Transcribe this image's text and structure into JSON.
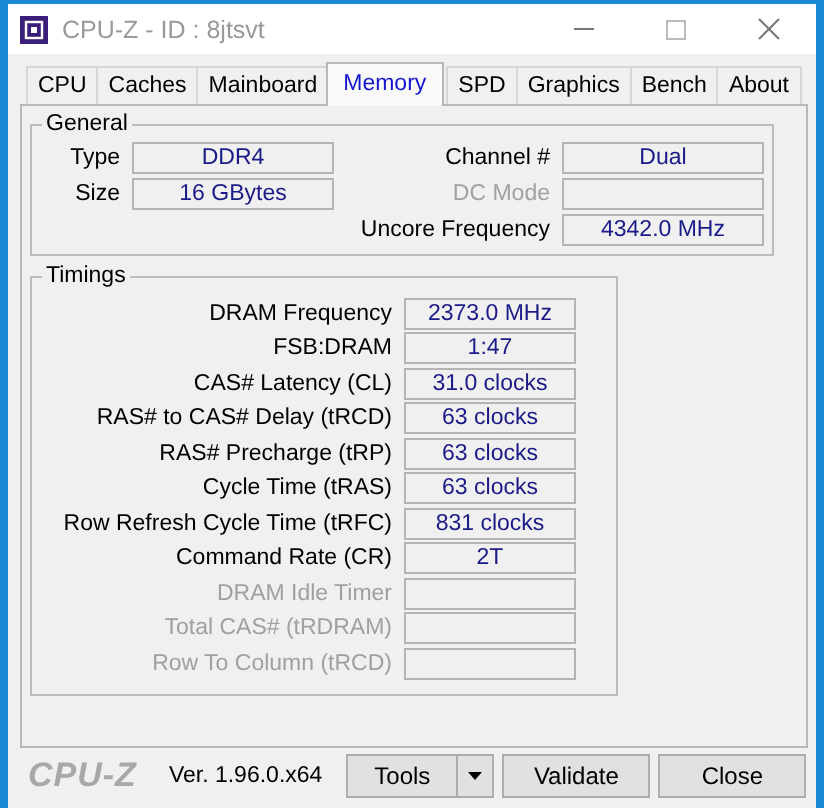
{
  "window": {
    "title": "CPU-Z - ID : 8jtsvt"
  },
  "tabs": [
    {
      "label": "CPU",
      "selected": false
    },
    {
      "label": "Caches",
      "selected": false
    },
    {
      "label": "Mainboard",
      "selected": false
    },
    {
      "label": "Memory",
      "selected": true
    },
    {
      "label": "SPD",
      "selected": false
    },
    {
      "label": "Graphics",
      "selected": false
    },
    {
      "label": "Bench",
      "selected": false
    },
    {
      "label": "About",
      "selected": false
    }
  ],
  "general": {
    "title": "General",
    "left": [
      {
        "label": "Type",
        "value": "DDR4",
        "disabled": false
      },
      {
        "label": "Size",
        "value": "16 GBytes",
        "disabled": false
      }
    ],
    "right": [
      {
        "label": "Channel #",
        "value": "Dual",
        "disabled": false
      },
      {
        "label": "DC Mode",
        "disabled": true
      },
      {
        "label": "Uncore Frequency",
        "value": "4342.0 MHz",
        "disabled": false
      }
    ]
  },
  "timings": {
    "title": "Timings",
    "rows": [
      {
        "label": "DRAM Frequency",
        "value": "2373.0 MHz",
        "disabled": false
      },
      {
        "label": "FSB:DRAM",
        "value": "1:47",
        "disabled": false
      },
      {
        "label": "CAS# Latency (CL)",
        "value": "31.0 clocks",
        "disabled": false
      },
      {
        "label": "RAS# to CAS# Delay (tRCD)",
        "value": "63 clocks",
        "disabled": false
      },
      {
        "label": "RAS# Precharge (tRP)",
        "value": "63 clocks",
        "disabled": false
      },
      {
        "label": "Cycle Time (tRAS)",
        "value": "63 clocks",
        "disabled": false
      },
      {
        "label": "Row Refresh Cycle Time (tRFC)",
        "value": "831 clocks",
        "disabled": false
      },
      {
        "label": "Command Rate (CR)",
        "value": "2T",
        "disabled": false
      },
      {
        "label": "DRAM Idle Timer",
        "disabled": true
      },
      {
        "label": "Total CAS# (tRDRAM)",
        "disabled": true
      },
      {
        "label": "Row To Column (tRCD)",
        "disabled": true
      }
    ]
  },
  "footer": {
    "logo": "CPU-Z",
    "version": "Ver. 1.96.0.x64",
    "buttons": [
      {
        "label": "Tools",
        "kind": "dropdown"
      },
      {
        "label": "Validate",
        "kind": "plain"
      },
      {
        "label": "Close",
        "kind": "plain"
      }
    ]
  }
}
